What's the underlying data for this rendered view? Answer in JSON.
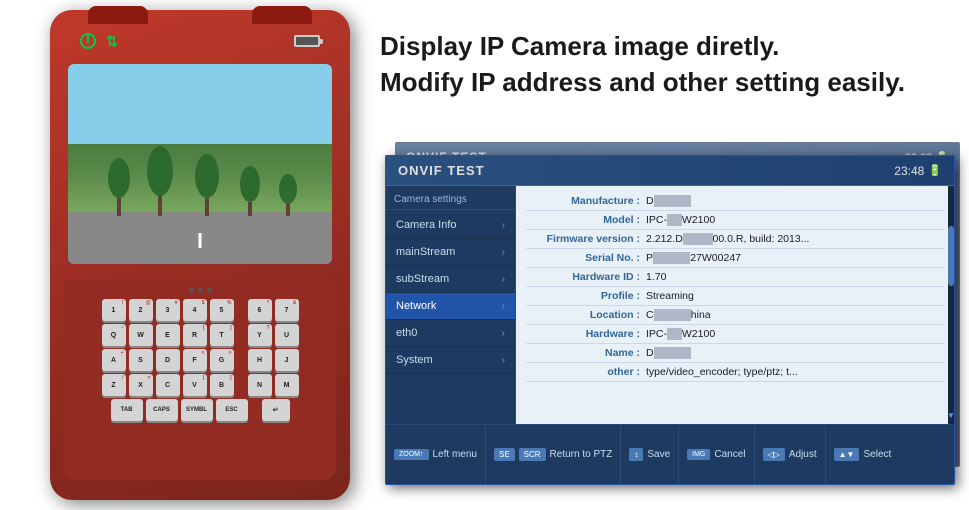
{
  "headline": {
    "line1": "Display IP Camera image diretly.",
    "line2": "Modify IP address and other setting easily."
  },
  "panel": {
    "title": "ONVIF TEST",
    "time": "23:48",
    "camera_settings_label": "Camera settings",
    "menu_items": [
      {
        "label": "Camera Info",
        "arrow": "›",
        "active": false
      },
      {
        "label": "mainStream",
        "arrow": "›",
        "active": false
      },
      {
        "label": "subStream",
        "arrow": "›",
        "active": false
      },
      {
        "label": "Network",
        "arrow": "›",
        "active": true
      },
      {
        "label": "eth0",
        "arrow": "›",
        "active": false
      },
      {
        "label": "System",
        "arrow": "›",
        "active": false
      }
    ],
    "info_rows": [
      {
        "label": "Manufacture :",
        "value": "D█████"
      },
      {
        "label": "Model :",
        "value": "IPC-██W2100"
      },
      {
        "label": "Firmware version :",
        "value": "2.212.D████00.0.R, build: 2013..."
      },
      {
        "label": "Serial No. :",
        "value": "P█████27W00247"
      },
      {
        "label": "Hardware ID :",
        "value": "1.70"
      },
      {
        "label": "Profile :",
        "value": "Streaming"
      },
      {
        "label": "Location :",
        "value": "C█████hina"
      },
      {
        "label": "Hardware :",
        "value": "IPC-██W2100"
      },
      {
        "label": "Name :",
        "value": "D█████"
      },
      {
        "label": "other :",
        "value": "type/video_encoder; type/ptz; t..."
      }
    ],
    "bottom_actions": [
      {
        "key": "ZOOM↑",
        "label": "Left menu"
      },
      {
        "key": "SE",
        "label": ""
      },
      {
        "key": "SCR",
        "label": "Return to PTZ"
      },
      {
        "key": "↕",
        "label": "Save"
      },
      {
        "key": "IMG",
        "label": ""
      },
      {
        "key": "↕",
        "label": "Cancel"
      },
      {
        "key": "◁▷",
        "label": "Adjust"
      },
      {
        "key": "▲▼",
        "label": "Select"
      }
    ]
  },
  "device": {
    "keys_row1": [
      "1!",
      "2@",
      "3#",
      "4$",
      "5%",
      "6^",
      "7&"
    ],
    "keys_row2": [
      "Q~",
      "W",
      "E",
      "R",
      "T",
      "Y?",
      "U"
    ],
    "keys_row3": [
      "A+",
      "S",
      "D",
      "F",
      "G>",
      "H",
      "J"
    ],
    "keys_row4": [
      "Z/",
      "X=",
      "C",
      "V[",
      "B]",
      "N",
      "M"
    ],
    "keys_row5": [
      "TAB",
      "CAPS",
      "SYMBL",
      "ESC",
      "↵"
    ]
  }
}
